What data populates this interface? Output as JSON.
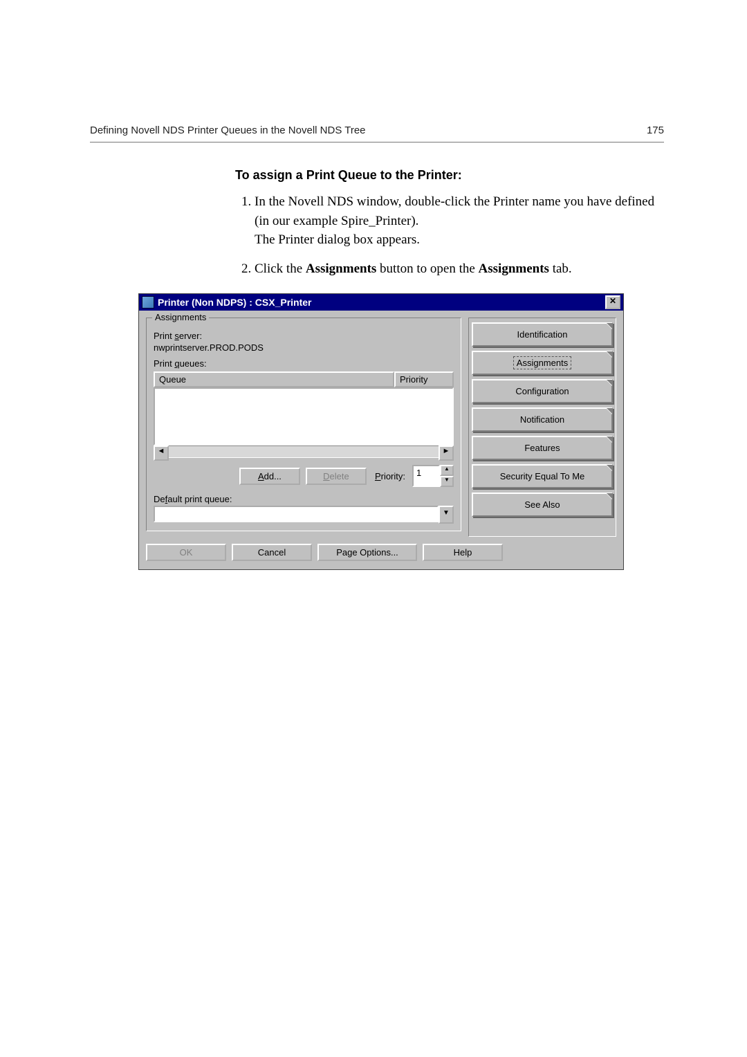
{
  "header": {
    "title": "Defining Novell NDS Printer Queues in the Novell NDS Tree",
    "page": "175"
  },
  "doc": {
    "heading": "To assign a Print Queue to the Printer:",
    "step1_a": "In the Novell NDS window, double-click the Printer name you have defined (in our example Spire_Printer).",
    "step1_b": "The Printer dialog box appears.",
    "step2_pre": "Click the ",
    "step2_b1": "Assignments",
    "step2_mid": " button to open the ",
    "step2_b2": "Assignments",
    "step2_post": " tab."
  },
  "dialog": {
    "title": "Printer (Non NDPS) : CSX_Printer",
    "group_label": "Assignments",
    "print_server_label_pre": "Print ",
    "print_server_label_u": "s",
    "print_server_label_post": "erver:",
    "print_server_value": "nwprintserver.PROD.PODS",
    "print_queues_label_pre": "Print ",
    "print_queues_label_u": "q",
    "print_queues_label_post": "ueues:",
    "col_queue": "Queue",
    "col_priority": "Priority",
    "btn_add_u": "A",
    "btn_add_rest": "dd...",
    "btn_delete_u": "D",
    "btn_delete_rest": "elete",
    "priority_label_u": "P",
    "priority_label_rest": "riority:",
    "priority_value": "1",
    "default_queue_label_pre": "De",
    "default_queue_label_u": "f",
    "default_queue_label_post": "ault print queue:",
    "tabs": {
      "identification": "Identification",
      "assignments": "Assignments",
      "configuration": "Configuration",
      "notification": "Notification",
      "features": "Features",
      "security": "Security Equal To Me",
      "seealso": "See Also"
    },
    "footer": {
      "ok": "OK",
      "cancel": "Cancel",
      "page_options": "Page Options...",
      "help": "Help"
    }
  }
}
